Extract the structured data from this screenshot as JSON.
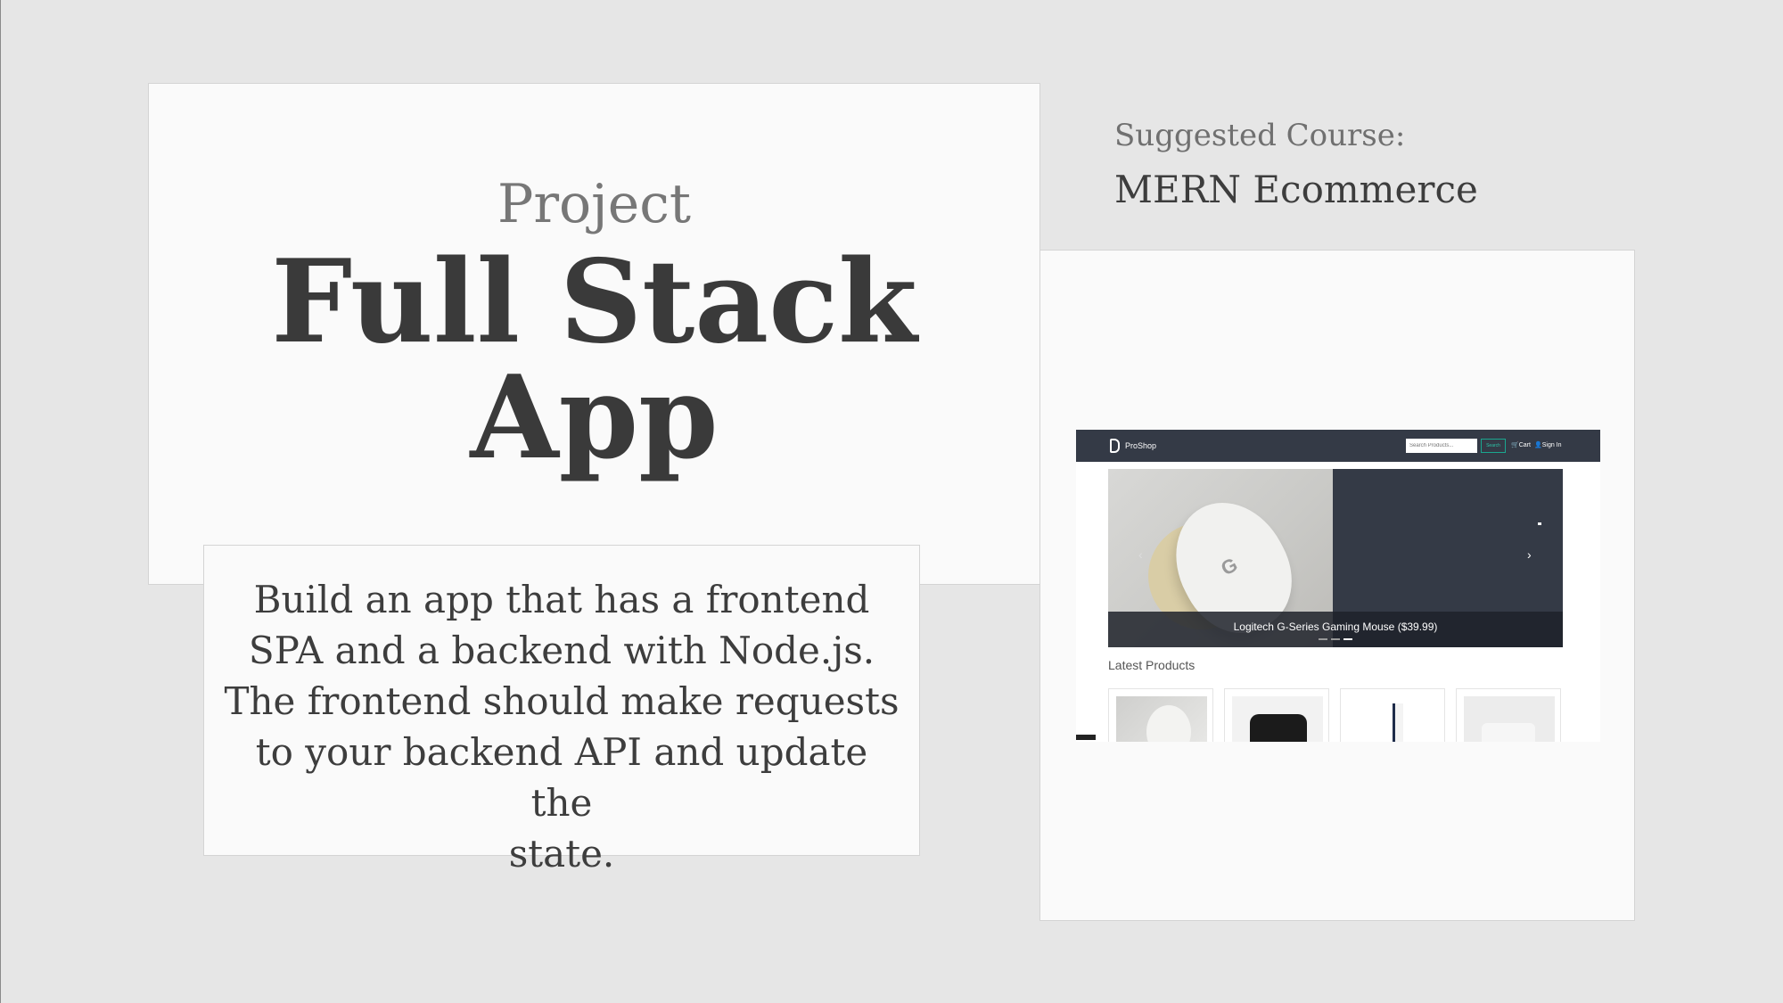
{
  "slide": {
    "kicker": "Project",
    "title_line1": "Full Stack",
    "title_line2": "App",
    "description_lines": [
      "Build an app that has a frontend",
      "SPA and a backend with Node.js.",
      "The frontend should make requests",
      "to your backend API and update the",
      "state."
    ],
    "suggested_label": "Suggested Course:",
    "suggested_course": "MERN Ecommerce"
  },
  "screenshot": {
    "brand": "ProShop",
    "search_placeholder": "Search Products...",
    "search_button": "Search",
    "cart": "Cart",
    "sign_in": "Sign In",
    "carousel_caption": "Logitech G-Series Gaming Mouse ($39.99)",
    "carousel_prev": "‹",
    "carousel_next": "›",
    "mouse_logo": "G",
    "latest_heading": "Latest Products",
    "products": [
      {
        "image": "gaming-mouse"
      },
      {
        "image": "camera"
      },
      {
        "image": "playstation"
      },
      {
        "image": "airpods"
      }
    ]
  },
  "colors": {
    "background": "#e6e6e6",
    "card": "#fafafa",
    "nav": "#343a46",
    "accent": "#1aa68f"
  }
}
